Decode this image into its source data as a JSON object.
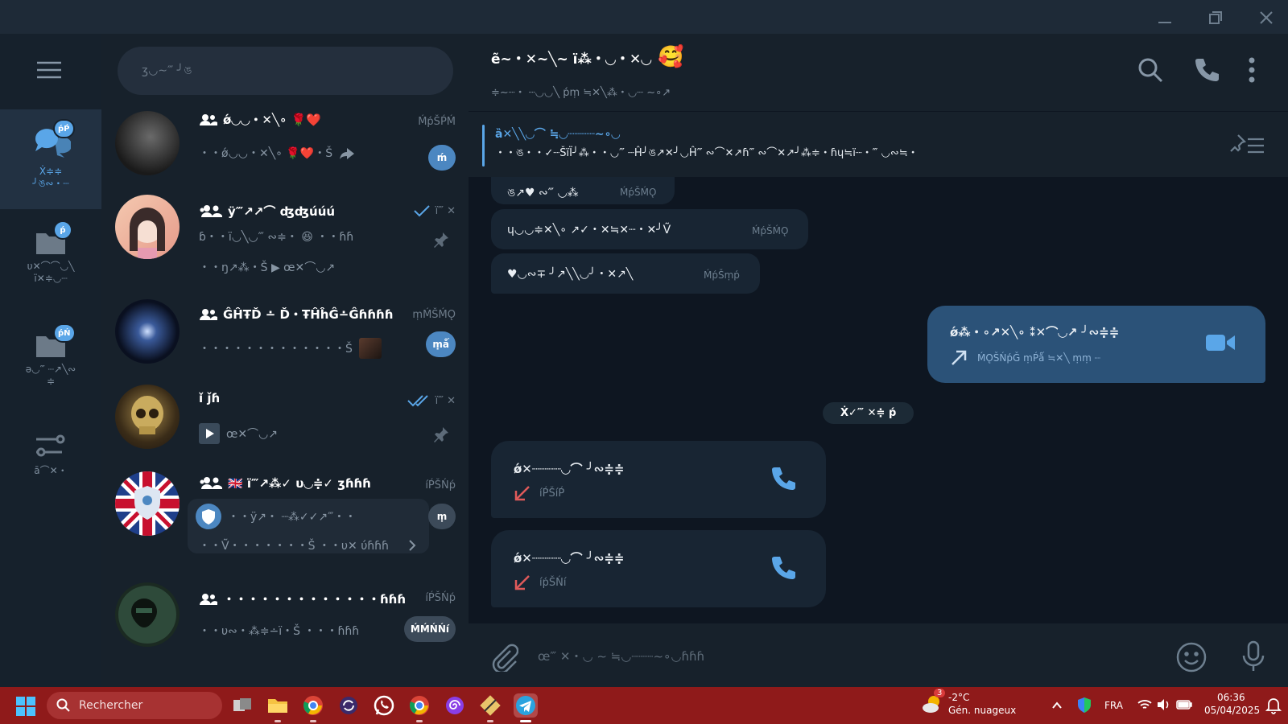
{
  "window": {
    "minimize_label": "minimize",
    "maximize_label": "maximize",
    "close_label": "close"
  },
  "folders": [
    {
      "label": "Ẋ≑≑\n╯ঙ∾・┈",
      "badge": "ṕṔ"
    },
    {
      "label": "υ✕⌒⌒◡╲\nï✕≑◡┈",
      "badge": "ṕ"
    },
    {
      "label": "ǝ◡‴ ┈↗╲∾\n≑",
      "badge": "ṕŃ"
    },
    {
      "label": "ā⌒✕・",
      "badge": ""
    }
  ],
  "search": {
    "placeholder": "ʒ◡∼‴ ╯ঙ"
  },
  "chats": [
    {
      "title": "ǿ◡◡・✕╲∘ 🌹❤️",
      "time": "ḾṕŠṔḾ",
      "preview": "・・ǿ◡◡・✕╲∘ 🌹❤️・Š",
      "badge": "ḿ"
    },
    {
      "title": "ÿ‴↗↗⌒ ʤʤúúú",
      "time": "ï‴ ✕",
      "preview": "ɓ・・ï◡╲◡‴ ∾≑・ 😆 ・・ɦɦ",
      "preview2": "・・ŋ↗⁂・Š ▶ œ✕⌒◡↗",
      "badge": ""
    },
    {
      "title": "ĜĤŦĎ ∸ Ď・ŦĤĥĜ∸Ĝɦɦɦɦ",
      "time": "ṃḾŠḾǪ",
      "preview": "・・・・・・・・・・・・・Š",
      "badge": "ṃǻ"
    },
    {
      "title": "ǐ   ǰɦ",
      "time": "ï‴ ✕",
      "preview": "œ✕⌒◡↗",
      "badge": ""
    },
    {
      "title": "🇬🇧 ï‴↗⁂✓ υ◡≑✓ ʒɦɦɦ",
      "time": "íṔŠŃṕ",
      "preview": "・・ÿ↗・ ┈⁂✓✓↗‴・・",
      "preview2": "・・Ṽ・・・・・・・Š ・・υ✕ ύɦɦɦ",
      "badge": "ṃ"
    },
    {
      "title": "・・・・・・・・・・・・・ɦɦɦ",
      "time": "íṔŠŃṕ",
      "preview": "・・υ∾・⁂≑∸ï・Š ・・・ɦɦɦ",
      "badge": "ḾḾŃŃí"
    }
  ],
  "header": {
    "title": "ẽ∼・✕∼╲∼ ï⁂・◡・✕◡",
    "title_emoji": "🥰",
    "subtitle": "≑∼┈・ ┈◡◡╲ ṕṃ ≒✕╲⁂・◡┈ ∼∘↗"
  },
  "pinned": {
    "title": "ȁ✕╲╲◡⌒ ≒◡┈┈┈┈∼∘◡",
    "text": "・・ঙ・・✓┈ŠïÏ╯⁂・・◡‴ ┈Ĥ╯ঙ↗✕╯◡Ĥ‴ ∾⌒✕↗ɦ‴ ∾⌒✕↗╯⁂≑・ɦɥ≒ï┈・‴ ◡∾≒・"
  },
  "messages": [
    {
      "text": "ঙ↗♥ ∾‴ ◡⁂",
      "time": "ḾṕŠḾǪ"
    },
    {
      "text": "ɥ◡◡≑✕╲∘ ↗✓・✕≒✕┈・✕╯Ṽ",
      "time": "ḾṕŠḾǪ"
    },
    {
      "text": "♥◡∾∓ ╯↗╲╲◡╯・✕↗╲",
      "time": "ḾṕŠṃṕ"
    }
  ],
  "outgoing_call": {
    "title": "ǿ⁂・∘↗✕╲∘ ⁑✕⌒◡↗ ╯∾≑≑",
    "meta": "ḾǪŠŃṕǦ ṃṔǻ ≒✕╲ ṃṃ ┈"
  },
  "date_separator": "Ẋ✓‴ ✕≑ ṕ",
  "missed_calls": [
    {
      "title": "ǿ✕┈┈┈┈◡⌒ ╯∾≑≑",
      "time": "íṔŠíṔ"
    },
    {
      "title": "ǿ✕┈┈┈┈◡⌒ ╯∾≑≑",
      "time": "íṕŠŃí"
    }
  ],
  "composer": {
    "placeholder": "œ‴ ✕・◡ ∼ ≒◡┈┈┈∼∘◡ɦɦɦ"
  },
  "taskbar": {
    "search_label": "Rechercher",
    "weather_temp": "-2°C",
    "weather_desc": "Gén. nuageux",
    "weather_badge": "3",
    "language": "FRA",
    "time": "06:36",
    "date": "05/04/2025"
  }
}
